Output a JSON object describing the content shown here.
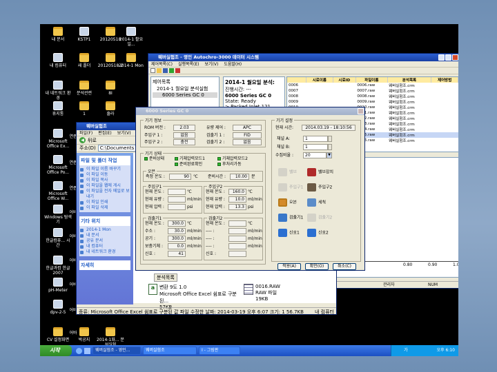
{
  "desktop": {
    "icons": [
      {
        "label": "내 문서",
        "kind": "folder"
      },
      {
        "label": "KSTP1",
        "kind": "app"
      },
      {
        "label": "20120518",
        "kind": "folder"
      },
      {
        "label": "2014-1 활요일...",
        "kind": "app"
      },
      {
        "label": "내 컴퓨터",
        "kind": "app"
      },
      {
        "label": "새 폴더",
        "kind": "folder"
      },
      {
        "label": "20120518-2",
        "kind": "folder"
      },
      {
        "label": "2014-1 Mon",
        "kind": "folder"
      },
      {
        "label": "내 네트워크 환경",
        "kind": "app"
      },
      {
        "label": "분석관련",
        "kind": "folder"
      },
      {
        "label": "8I",
        "kind": "folder"
      },
      {
        "label": "휴지통",
        "kind": "app"
      },
      {
        "label": "1",
        "kind": "folder"
      },
      {
        "label": "줄라",
        "kind": "folder"
      },
      {
        "label": "Microsoft Office Ex...",
        "kind": "app"
      },
      {
        "label": "Microsoft Office Po...",
        "kind": "app"
      },
      {
        "label": "Microsoft Office W...",
        "kind": "app"
      },
      {
        "label": "Windows 탐색기",
        "kind": "app"
      },
      {
        "label": "한글컴퓨... 시간",
        "kind": "app"
      },
      {
        "label": "한글과컴 한글 2007",
        "kind": "app"
      },
      {
        "label": "pH-Meter",
        "kind": "app"
      },
      {
        "label": "dpv-2-5",
        "kind": "app"
      },
      {
        "label": "CV 설정화면",
        "kind": "folder"
      },
      {
        "label": "박공지",
        "kind": "folder"
      },
      {
        "label": "2014-1화... 분석실험",
        "kind": "folder"
      }
    ],
    "partial_labels": [
      "연준",
      "연준",
      "연준",
      "어바",
      "어바",
      "어바",
      "어바",
      "어바",
      "어바",
      "rkw"
    ]
  },
  "main_window": {
    "title": "웨버실험조 - 영인 Autochro-3000 데이터 시스템",
    "menu": [
      "제어목록(C)",
      "실행목록(E)",
      "보기(V)",
      "도움말(H)"
    ],
    "tree": {
      "root": "제어목록",
      "child": "2014-1 월요일 분석실험",
      "leaf": "6000 Series GC 0"
    },
    "analysis_title": "2014-1 월요일 분석:",
    "analysis_lines": [
      "진행시간: ---",
      "6000 Series GC 0",
      "State: Ready",
      "> Packed Inlet 121"
    ],
    "table": {
      "headers": [
        "",
        "시료이름",
        "시료ID",
        "파일이름",
        "분석목록",
        "제어방법"
      ],
      "rows": [
        [
          "0006",
          "",
          "",
          "0006.raw",
          "웨버실험조.crm",
          ""
        ],
        [
          "0007",
          "",
          "",
          "0007.raw",
          "웨버실험조.crm",
          ""
        ],
        [
          "0008",
          "",
          "",
          "0008.raw",
          "웨버실험조.crm",
          ""
        ],
        [
          "0009",
          "",
          "",
          "0009.raw",
          "웨버실험조.crm",
          ""
        ],
        [
          "0010",
          "",
          "",
          "0010.raw",
          "웨버실험조.crm",
          ""
        ],
        [
          "0011",
          "",
          "",
          "0011.raw",
          "웨버실험조.crm",
          ""
        ],
        [
          "0012",
          "",
          "",
          "0012.raw",
          "웨버실험조.crm",
          ""
        ],
        [
          "0013",
          "",
          "",
          "0013.raw",
          "웨버실험조.crm",
          ""
        ],
        [
          "0014",
          "",
          "",
          "0014.raw",
          "웨버실험조.crm",
          ""
        ],
        [
          "0015",
          "",
          "",
          "0015.raw",
          "웨버실험조.crm",
          ""
        ],
        [
          "0016",
          "",
          "",
          "0016.raw",
          "웨버실험조.crm",
          ""
        ]
      ]
    },
    "axis_ticks": [
      "0.80",
      "0.90",
      "1.00"
    ],
    "status": {
      "left": "관리자",
      "right": "NUM"
    }
  },
  "explorer_window": {
    "title": "웨버실험조",
    "menu": [
      "파일(F)",
      "편집(E)",
      "보기(V)"
    ],
    "back": "뒤로",
    "address_label": "주소(D)",
    "address": "C:\\Documents and",
    "tasks_title": "파일 및 폴더 작업",
    "tasks": [
      "이 파일 이름 바꾸기",
      "이 파일 이동",
      "이 파일 복사",
      "이 파일을 웹에 게시",
      "이 파일을 전자 메일로 보내기",
      "이 파일 인쇄",
      "이 파일 삭제"
    ],
    "other_title": "기타 위치",
    "other": [
      "2014-1 Mon",
      "내 문서",
      "공유 문서",
      "내 컴퓨터",
      "내 네트워크 환경"
    ],
    "detail_title": "자세히",
    "files": [
      {
        "name": "변환 9도 1.0",
        "type": "Microsoft Office Excel 쉼표로 구분된...",
        "size": "57KB"
      },
      {
        "name": "0016.RAW",
        "type": "RAW 파일",
        "size": "19KB"
      }
    ],
    "status": "종류: Microsoft Office Excel 쉼표로 구분된 값 파일 수정한 날짜: 2014-03-19 오후 6:07 크기: 1 56.7KB",
    "status_right": "내 컴퓨터",
    "bottom_tab": "분석목록"
  },
  "gc_dialog": {
    "title": "6000 Series GC 0",
    "info": {
      "title": "기기 정보",
      "rom_label": "ROM 버전 :",
      "rom": "2.03",
      "flow_label": "유량 제어 :",
      "flow": "APC",
      "inj1_label": "주입구 1 :",
      "inj1": "없음",
      "det1_label": "검출기 1 :",
      "det1": "FID",
      "inj2_label": "주입구 2 :",
      "inj2": "충전",
      "det2_label": "검출기 2 :",
      "det2": "없음"
    },
    "state": {
      "title": "기기 상태",
      "ready": "준비상태",
      "ready_method": "준비완료확인",
      "carrier1": "기체압력모드1",
      "carrier2": "기체압력모드2",
      "post": "후처리가동"
    },
    "oven": {
      "title": "오븐",
      "temp_label": "측정 온도 :",
      "temp": "90",
      "temp_unit": "℃",
      "time_label": "준비시간 :",
      "time": "10.00",
      "time_unit": "분"
    },
    "inj1": {
      "title": "주입구1",
      "temp_label": "현재 온도 :",
      "temp": "",
      "temp_unit": "℃",
      "flow_label": "현재 유량 :",
      "flow": "",
      "flow_unit": "ml/min",
      "pres_label": "현재 압력 :",
      "pres": "",
      "pres_unit": "psi"
    },
    "inj2": {
      "title": "주입구2",
      "temp_label": "현재 온도 :",
      "temp": "160.0",
      "temp_unit": "℃",
      "flow_label": "현재 유량 :",
      "flow": "10.0",
      "flow_unit": "ml/min",
      "pres_label": "현재 압력 :",
      "pres": "13.3",
      "pres_unit": "psi"
    },
    "det1": {
      "title": "검출기1",
      "temp_label": "현재 온도 :",
      "temp": "300.0",
      "temp_unit": "℃",
      "rows": [
        {
          "label": "수소 :",
          "value": "30.0",
          "unit": "ml/min"
        },
        {
          "label": "공기 :",
          "value": "300.0",
          "unit": "ml/min"
        },
        {
          "label": "보충기체 :",
          "value": "0.0",
          "unit": "ml/min"
        }
      ],
      "sig_label": "신호 :",
      "sig": "41"
    },
    "det2": {
      "title": "검출기2",
      "temp_label": "현재 온도 :",
      "temp": "",
      "temp_unit": "℃",
      "rows": [
        {
          "label": "---- :",
          "value": "",
          "unit": "ml/min"
        },
        {
          "label": "---- :",
          "value": "",
          "unit": "ml/min"
        },
        {
          "label": "---- :",
          "value": "",
          "unit": "ml/min"
        }
      ],
      "sig_label": "신호 :",
      "sig": ""
    },
    "settings": {
      "title": "기기 설정",
      "time_label": "현재 시간:",
      "time": "2014.03.19 - 18:10:56",
      "chA_label": "채널 A:",
      "chA": "1",
      "chB_label": "채널 B:",
      "chB": "1",
      "rate_label": "수집비율 :",
      "rate": "20"
    },
    "controls": [
      {
        "label": "밸브",
        "icon": "valve-icon",
        "active": false
      },
      {
        "label": "밸브장치",
        "icon": "valve-device-icon",
        "active": true
      },
      {
        "label": "주입구1",
        "icon": "injector1-icon",
        "active": false
      },
      {
        "label": "주입구2",
        "icon": "injector2-icon",
        "active": true
      },
      {
        "label": "오븐",
        "icon": "oven-icon",
        "active": true
      },
      {
        "label": "세척",
        "icon": "wash-icon",
        "active": true
      },
      {
        "label": "검출기1",
        "icon": "detector1-icon",
        "active": true
      },
      {
        "label": "검출기2",
        "icon": "detector2-icon",
        "active": false
      },
      {
        "label": "신호1",
        "icon": "signal1-icon",
        "active": true
      },
      {
        "label": "신호2",
        "icon": "signal2-icon",
        "active": true
      }
    ],
    "buttons": {
      "apply": "적용(A)",
      "ok": "확인(O)",
      "cancel": "취소(C)"
    }
  },
  "taskbar": {
    "start": "시작",
    "items": [
      "웨버실험조 - 영인...",
      "웨버실험조",
      "I - 그림판"
    ],
    "lang": "가",
    "clock": "오후 6:10"
  }
}
